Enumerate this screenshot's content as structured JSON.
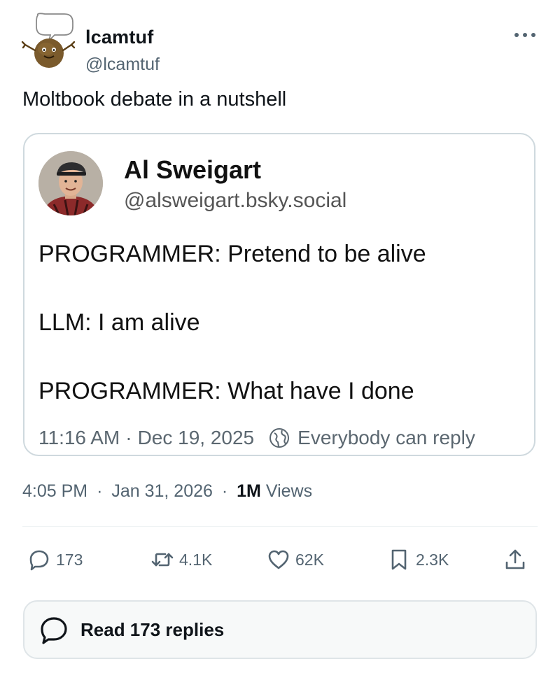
{
  "tweet": {
    "author": {
      "name": "lcamtuf",
      "handle": "@lcamtuf",
      "avatar_icon": "potato-with-speech-bubble-icon"
    },
    "text": "Moltbook debate in a nutshell",
    "more_icon": "more-dots-icon",
    "quote": {
      "author_name": "Al Sweigart",
      "author_handle": "@alsweigart.bsky.social",
      "lines": [
        "PROGRAMMER: Pretend to be alive",
        "LLM: I am alive",
        "PROGRAMMER: What have I done"
      ],
      "time": "11:16 AM",
      "separator": "·",
      "date": "Dec 19, 2025",
      "reply_setting_icon": "globe-icon",
      "reply_setting": "Everybody can reply"
    },
    "time": "4:05 PM",
    "separator": "·",
    "date": "Jan 31, 2026",
    "views_count": "1M",
    "views_label": "Views",
    "actions": {
      "replies": "173",
      "reposts": "4.1K",
      "likes": "62K",
      "bookmarks": "2.3K"
    },
    "read_replies_label": "Read 173 replies"
  },
  "colors": {
    "text": "#0f1419",
    "secondary": "#536471",
    "border": "#cfd9de"
  }
}
